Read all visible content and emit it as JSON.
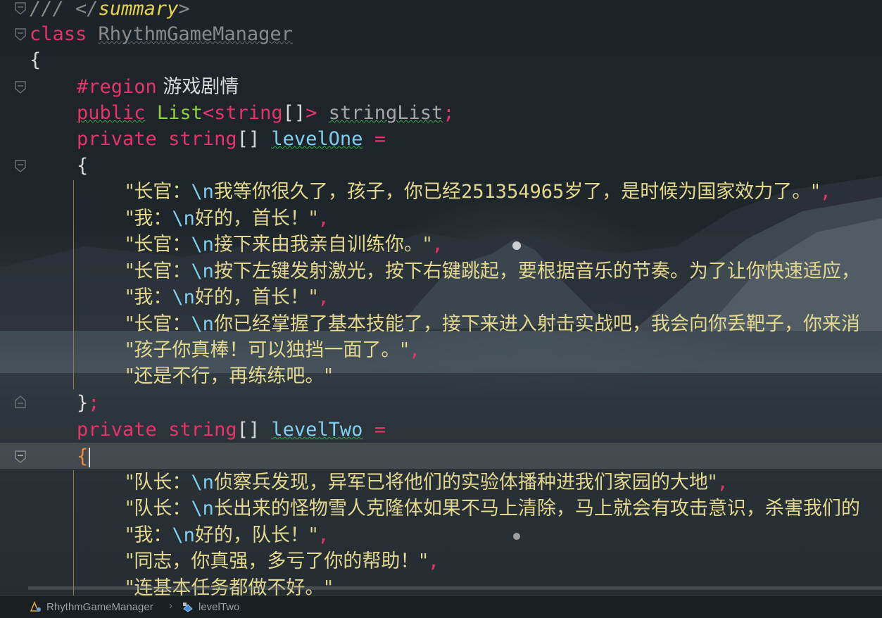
{
  "editor": {
    "lines": {
      "l1": [
        "///",
        " </",
        "summary",
        ">"
      ],
      "l2": [
        "class",
        " ",
        "RhythmGameManager"
      ],
      "l3": [
        "{"
      ],
      "l4": [
        "#region",
        " 游戏剧情"
      ],
      "l5": [
        "public",
        " ",
        "List",
        "<",
        "string",
        "[]",
        ">",
        " ",
        "stringList",
        ";"
      ],
      "l6": [
        "private",
        " ",
        "string",
        "[]",
        " ",
        "levelOne",
        " ="
      ],
      "l7": [
        "{"
      ],
      "l8": [
        "\"长官：",
        "\\n",
        "我等你很久了，孩子，你已经",
        "251354965",
        "岁了，是时候为国家效力了。\"",
        ","
      ],
      "l9": [
        "\"我：",
        "\\n",
        "好的，首长！\"",
        ","
      ],
      "l10": [
        "\"长官：",
        "\\n",
        "接下来由我亲自训练你。\"",
        ","
      ],
      "l11": [
        "\"长官：",
        "\\n",
        "按下左键发射激光，按下右键跳起，要根据音乐的节奏。为了让你快速适应，"
      ],
      "l12": [
        "\"我：",
        "\\n",
        "好的，首长！\"",
        ","
      ],
      "l13": [
        "\"长官：",
        "\\n",
        "你已经掌握了基本技能了，接下来进入射击实战吧，我会向你丢靶子，你来消"
      ],
      "l14": [
        "\"孩子你真棒！可以独挡一面了。\"",
        ","
      ],
      "l15": [
        "\"还是不行，再练练吧。\""
      ],
      "l16": [
        "}",
        ";"
      ],
      "l17": [
        "private",
        " ",
        "string",
        "[]",
        " ",
        "levelTwo",
        " ="
      ],
      "l18": [
        "{"
      ],
      "l19": [
        "\"队长：",
        "\\n",
        "侦察兵发现，异军已将他们的实验体播种进我们家园的大地\"",
        ","
      ],
      "l20": [
        "\"队长：",
        "\\n",
        "长出来的怪物雪人克隆体如果不马上清除，马上就会有攻击意识，杀害我们的"
      ],
      "l21": [
        "\"我：",
        "\\n",
        "好的，队长！\"",
        ","
      ],
      "l22": [
        "\"同志，你真强，多亏了你的帮助！\"",
        ","
      ],
      "l23": [
        "\"连基本任务都做不好。\""
      ]
    }
  },
  "statusbar": {
    "class_name": "RhythmGameManager",
    "separator": "›",
    "member_name": "levelTwo",
    "class_icon": "class-icon",
    "member_icon": "field-icon"
  },
  "colors": {
    "keyword": "#e8336a",
    "type": "#8fcf3e",
    "field": "#7fd0ef",
    "string": "#e2d890",
    "comment": "#8a8a8a"
  }
}
